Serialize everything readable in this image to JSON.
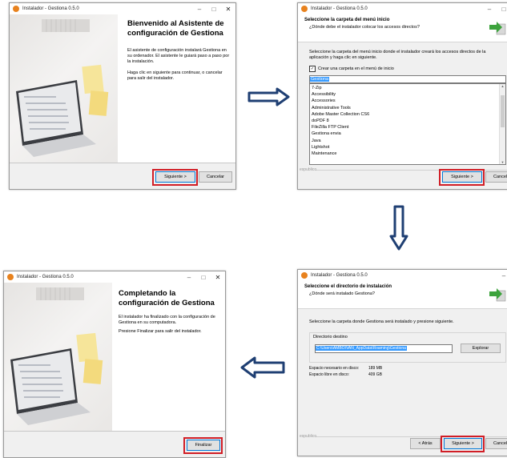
{
  "window_title": "Instalador - Gestiona 0.5.0",
  "titlebar_buttons": {
    "minimize": "–",
    "maximize": "□",
    "close": "✕"
  },
  "step1": {
    "heading": "Bienvenido al Asistente de configuración de Gestiona",
    "para1": "El asistente de configuración instalará Gestiona en su ordenador. El asistente le guiará paso a paso por la instalación.",
    "para2": "Haga clic en siguiente para continuar, o cancelar para salir del instalador.",
    "next": "Siguiente >",
    "cancel": "Cancelar"
  },
  "step2": {
    "title": "Seleccione la carpeta del menú inicio",
    "subtitle": "¿Dónde debe el instalador colocar los accesos directos?",
    "instruction": "Seleccione la carpeta del menú inicio donde el instalador creará los accesos directos de la aplicación y haga clic en siguiente.",
    "checkbox_label": "Crear una carpeta en el menú de inicio",
    "checkbox_mark": "✓",
    "folder_value": "Gestiona",
    "folders": [
      "7-Zip",
      "Accessibility",
      "Accessories",
      "Administrative Tools",
      "Adobe Master Collection CS6",
      "doPDF 8",
      "FileZilla FTP Client",
      "Gestiona envia",
      "Java",
      "Lightshot",
      "Maintenance"
    ],
    "brand": "espublico",
    "next": "Siguiente >",
    "cancel": "Cancelar"
  },
  "step3": {
    "title": "Seleccione el directorio de instalación",
    "subtitle": "¿Dónde será instalado Gestiona?",
    "instruction": "Seleccione la carpeta donde Gestiona será instalado y presione siguiente.",
    "dest_label": "Directorio destino",
    "dest_value": "C:\\Users\\AMBOIVAN_AppData\\Roaming\\Gestiona",
    "browse": "Explorar",
    "space_required_label": "Espacio necesario en disco:",
    "space_required_value": "189 MB",
    "space_free_label": "Espacio libre en disco:",
    "space_free_value": "409 GB",
    "brand": "espublico",
    "back": "< Atrás",
    "next": "Siguiente >",
    "cancel": "Cancelar"
  },
  "step4": {
    "heading": "Completando la configuración de Gestiona",
    "para1": "El instalador ha finalizado con la configuración de Gestiona en su computadora.",
    "para2": "Presione Finalizar para salir del instalador.",
    "finish": "Finalizar"
  },
  "colors": {
    "highlight": "#d11e26",
    "arrow": "#1f3f73",
    "selection": "#3399ff"
  }
}
